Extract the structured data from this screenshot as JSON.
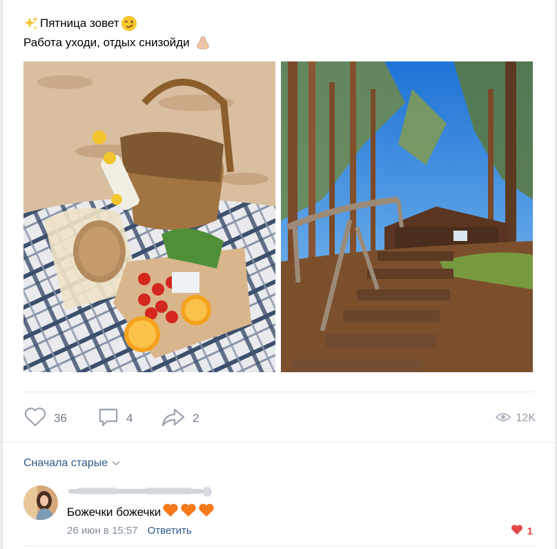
{
  "post": {
    "line1": "Пятница зовет",
    "line2": "Работа уходи, отдых снизойди"
  },
  "actions": {
    "likes": "36",
    "comments": "4",
    "shares": "2",
    "views": "12K"
  },
  "comments_section": {
    "sort_label": "Сначала старые"
  },
  "comment": {
    "text": "Божечки божечки",
    "date": "26 июн в 15:57",
    "reply_label": "Ответить",
    "likes": "1"
  },
  "icons": {
    "line1_prefix": "sparkles-icon",
    "line1_suffix": "winking-face-icon",
    "line2_suffix": "praying-hands-icon",
    "comment_hearts": "orange-heart-icon"
  },
  "colors": {
    "link": "#2a5885",
    "muted": "#818c99",
    "like_active": "#e64646"
  }
}
